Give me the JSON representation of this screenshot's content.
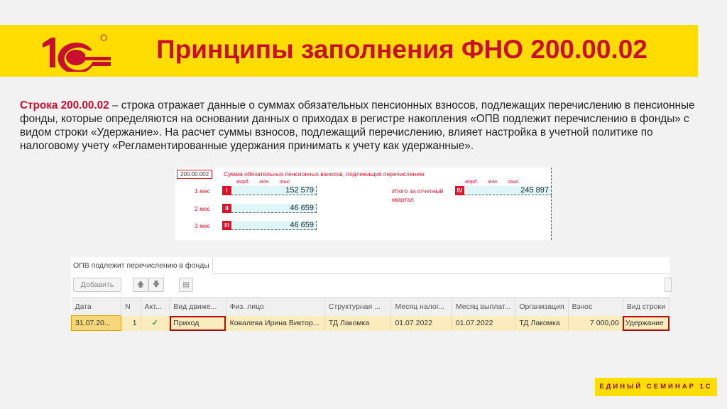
{
  "header": {
    "title": "Принципы заполнения ФНО 200.00.02",
    "logo": "1С"
  },
  "paragraph": {
    "bold": "Строка 200.00.02",
    "text": " – строка отражает данные о суммах обязательных пенсионных взносов, подлежащих перечислению в пенсионные фонды, которые определяются на основании данных о приходах в регистре накопления «ОПВ подлежит перечислению в фонды» с видом строки «Удержание». На расчет суммы взносов, подлежащий перечислению, влияет настройка в учетной политике по налоговому учету «Регламентированные удержания принимать к учету как удержанные»."
  },
  "form": {
    "code": "200.00.002",
    "title": "Сумма обязательных пенсионных взносов, подлежащих перечислению",
    "units": "млрд. млн. тыс.",
    "rows": [
      {
        "label": "1 мес",
        "roman": "I",
        "value": "152 579"
      },
      {
        "label": "2 мес",
        "roman": "II",
        "value": "46 659"
      },
      {
        "label": "3 мес",
        "roman": "III",
        "value": "46 659"
      }
    ],
    "total": {
      "label1": "Итого за отчетный",
      "label2": "квартал",
      "roman": "IV",
      "value": "245 897"
    }
  },
  "register": {
    "tab": "ОПВ подлежит перечислению в фонды",
    "add": "Добавить",
    "columns": [
      "Дата",
      "N",
      "Акт...",
      "Вид движе...",
      "Физ. лицо",
      "Структурная ...",
      "Месяц налог...",
      "Месяц выплат...",
      "Организация",
      "Взнос",
      "Вид строки"
    ],
    "row": [
      "31.07.20...",
      "1",
      "✓",
      "Приход",
      "Ковалева Ирина Виктор...",
      "ТД Лакомка",
      "01.07.2022",
      "01.07.2022",
      "ТД Лакомка",
      "7 000,00",
      "Удержание"
    ]
  },
  "footer": {
    "badge": "ЕДИНЫЙ СЕМИНАР 1С"
  }
}
